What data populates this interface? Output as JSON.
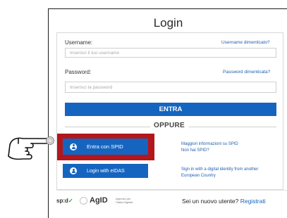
{
  "login": {
    "title": "Login",
    "username_label": "Username:",
    "username_forgot": "Username dimenticato?",
    "username_placeholder": "Inserisci il tuo username",
    "password_label": "Password:",
    "password_forgot": "Password dimenticata?",
    "password_placeholder": "Inserisci la password",
    "submit_label": "ENTRA",
    "or_label": "OPPURE"
  },
  "spid": {
    "button_label": "Entra con SPID",
    "info_line1": "Maggiori informazioni su SPID",
    "info_line2": "Non hai SPID?",
    "highlight_color": "#b3161b"
  },
  "eidas": {
    "button_label": "Login with eIDAS",
    "info_line1": "Sign in with a digital identity from another",
    "info_line2": "European Country"
  },
  "footer": {
    "spid_logo_text": "sp:d",
    "agid_logo_text": "AgID",
    "agid_subtext_line1": "Agenzia per",
    "agid_subtext_line2": "l'Italia Digitale",
    "new_user_text": "Sei un nuovo utente?",
    "register_link": "Registrati"
  },
  "icons": {
    "pointer": "pointing-hand-icon",
    "user": "user-icon"
  },
  "colors": {
    "primary": "#1565c0",
    "link": "#1f5fad",
    "spid_check": "#2e9c3b"
  }
}
